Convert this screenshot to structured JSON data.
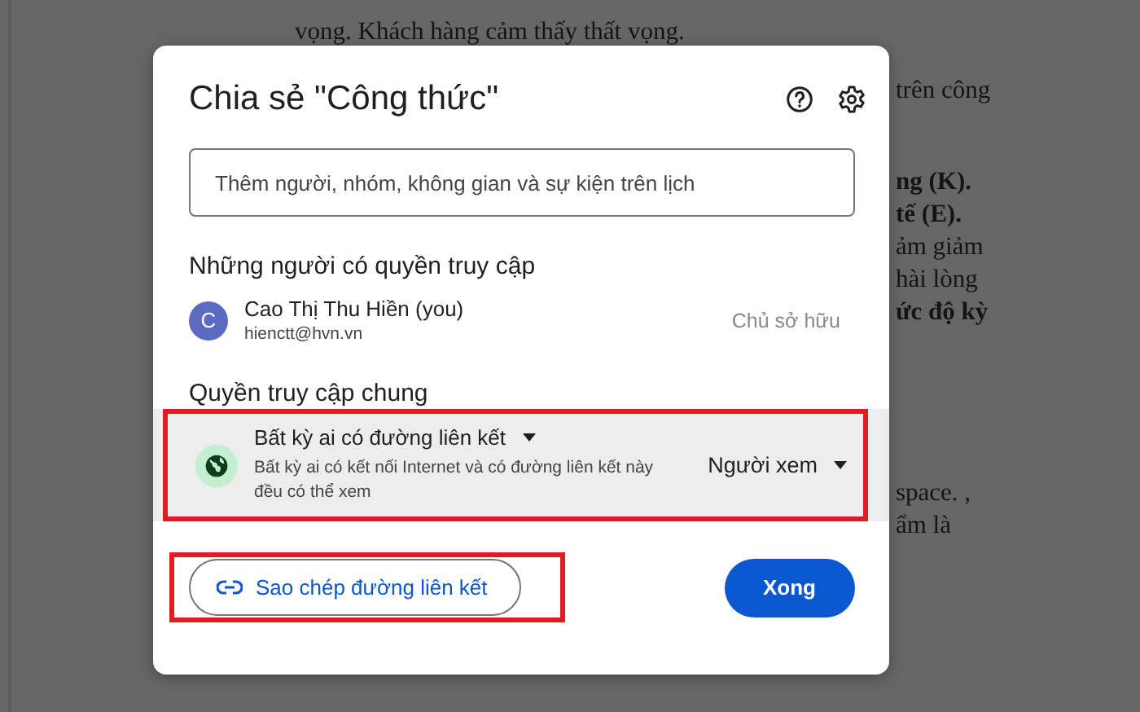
{
  "document": {
    "top_lines": [
      {
        "text": "vọng. Khách hàng cảm thấy thất vọng."
      }
    ],
    "fragments": [
      [
        {
          "text": "trên công",
          "bold": false
        }
      ],
      [
        {
          "text": "ng (K).",
          "bold": true
        },
        {
          "text": "tế (E).",
          "bold": true
        }
      ],
      [
        {
          "text": "ảm giảm",
          "bold": false
        },
        {
          "text": "hài lòng",
          "bold": false
        },
        {
          "text": "ức độ kỳ",
          "bold": true
        }
      ],
      [
        {
          "text": "space. ,",
          "bold": false
        },
        {
          "text": "ẩm là",
          "bold": false
        }
      ]
    ]
  },
  "dialog": {
    "title": "Chia sẻ \"Công thức\"",
    "search": {
      "placeholder": "Thêm người, nhóm, không gian và sự kiện trên lịch"
    },
    "people_heading": "Những người có quyền truy cập",
    "people": [
      {
        "initial": "C",
        "name": "Cao Thị Thu Hiền (you)",
        "email": "hienctt@hvn.vn",
        "role": "Chủ sở hữu",
        "color": "#5c6bc0"
      }
    ],
    "general_heading": "Quyền truy cập chung",
    "general_access": {
      "title": "Bất kỳ ai có đường liên kết",
      "description": "Bất kỳ ai có kết nối Internet và có đường liên kết này đều có thể xem",
      "role": "Người xem",
      "highlighted": true
    },
    "copy_link": {
      "label": "Sao chép đường liên kết",
      "highlighted": true
    },
    "done": {
      "label": "Xong"
    }
  }
}
